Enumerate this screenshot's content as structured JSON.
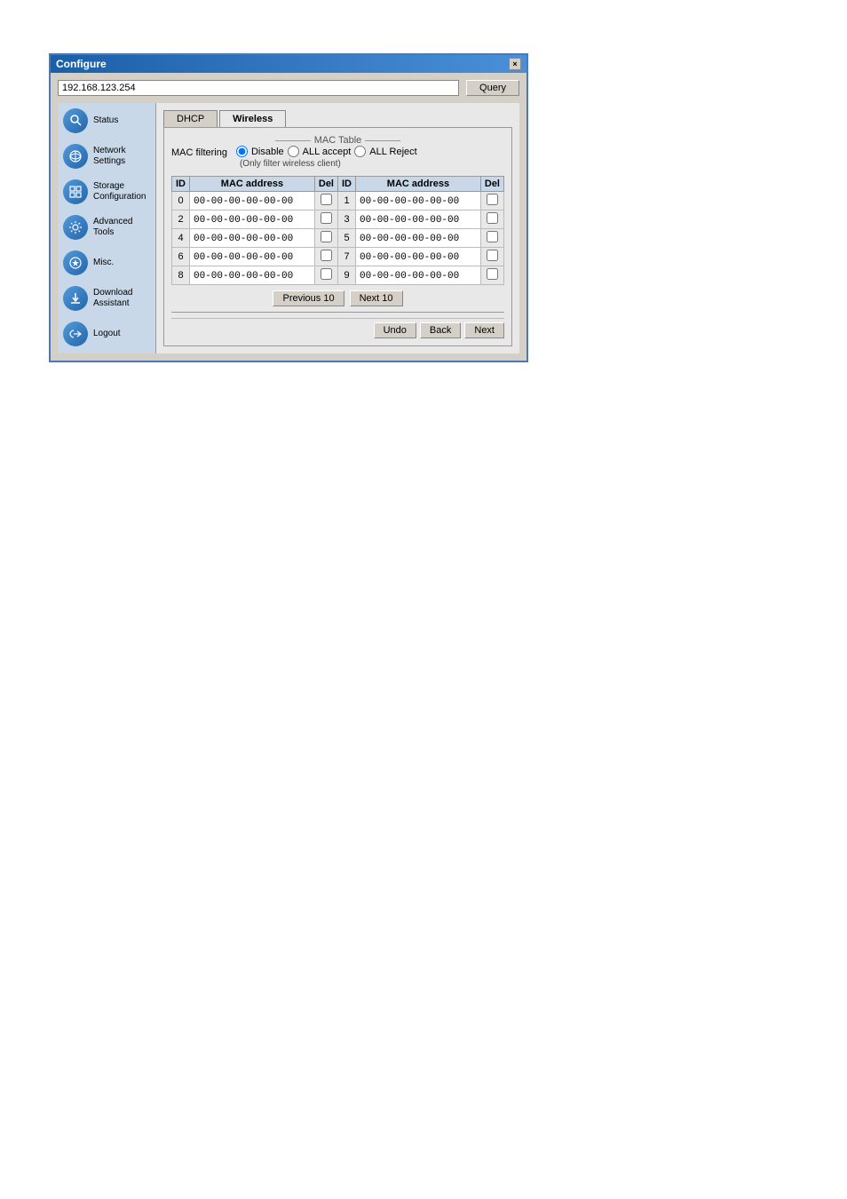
{
  "window": {
    "title": "Configure",
    "close_label": "×"
  },
  "address_bar": {
    "ip_address": "192.168.123.254",
    "query_button_label": "Query"
  },
  "sidebar": {
    "items": [
      {
        "id": "status",
        "label": "Status",
        "icon": "🔍"
      },
      {
        "id": "network-settings",
        "label": "Network\nSettings",
        "icon": "🌐"
      },
      {
        "id": "storage-configuration",
        "label": "Storage\nConfiguration",
        "icon": "⊞"
      },
      {
        "id": "advanced-tools",
        "label": "Advanced\nTools",
        "icon": "⚙"
      },
      {
        "id": "misc",
        "label": "Misc.",
        "icon": "🕐"
      },
      {
        "id": "download-assistant",
        "label": "Download\nAssistant",
        "icon": "⬇"
      },
      {
        "id": "logout",
        "label": "Logout",
        "icon": "↩"
      }
    ]
  },
  "tabs": [
    {
      "id": "dhcp",
      "label": "DHCP"
    },
    {
      "id": "wireless",
      "label": "Wireless",
      "active": true
    }
  ],
  "mac_table": {
    "section_title": "MAC Table",
    "filtering_label": "MAC filtering",
    "filter_options": [
      {
        "id": "disable",
        "label": "Disable",
        "checked": true
      },
      {
        "id": "all-accept",
        "label": "ALL accept",
        "checked": false
      },
      {
        "id": "all-reject",
        "label": "ALL Reject",
        "checked": false
      }
    ],
    "hint_text": "(Only filter wireless client)",
    "columns_left": [
      "ID",
      "MAC address",
      "Del"
    ],
    "columns_right": [
      "ID",
      "MAC address",
      "Del"
    ],
    "rows": [
      {
        "id_left": "0",
        "mac_left": "00-00-00-00-00-00",
        "del_left": false,
        "id_right": "1",
        "mac_right": "00-00-00-00-00-00",
        "del_right": false
      },
      {
        "id_left": "2",
        "mac_left": "00-00-00-00-00-00",
        "del_left": false,
        "id_right": "3",
        "mac_right": "00-00-00-00-00-00",
        "del_right": false
      },
      {
        "id_left": "4",
        "mac_left": "00-00-00-00-00-00",
        "del_left": false,
        "id_right": "5",
        "mac_right": "00-00-00-00-00-00",
        "del_right": false
      },
      {
        "id_left": "6",
        "mac_left": "00-00-00-00-00-00",
        "del_left": false,
        "id_right": "7",
        "mac_right": "00-00-00-00-00-00",
        "del_right": false
      },
      {
        "id_left": "8",
        "mac_left": "00-00-00-00-00-00",
        "del_left": false,
        "id_right": "9",
        "mac_right": "00-00-00-00-00-00",
        "del_right": false
      }
    ],
    "prev_button_label": "Previous 10",
    "next_button_label": "Next 10"
  },
  "action_buttons": {
    "undo_label": "Undo",
    "back_label": "Back",
    "next_label": "Next"
  }
}
